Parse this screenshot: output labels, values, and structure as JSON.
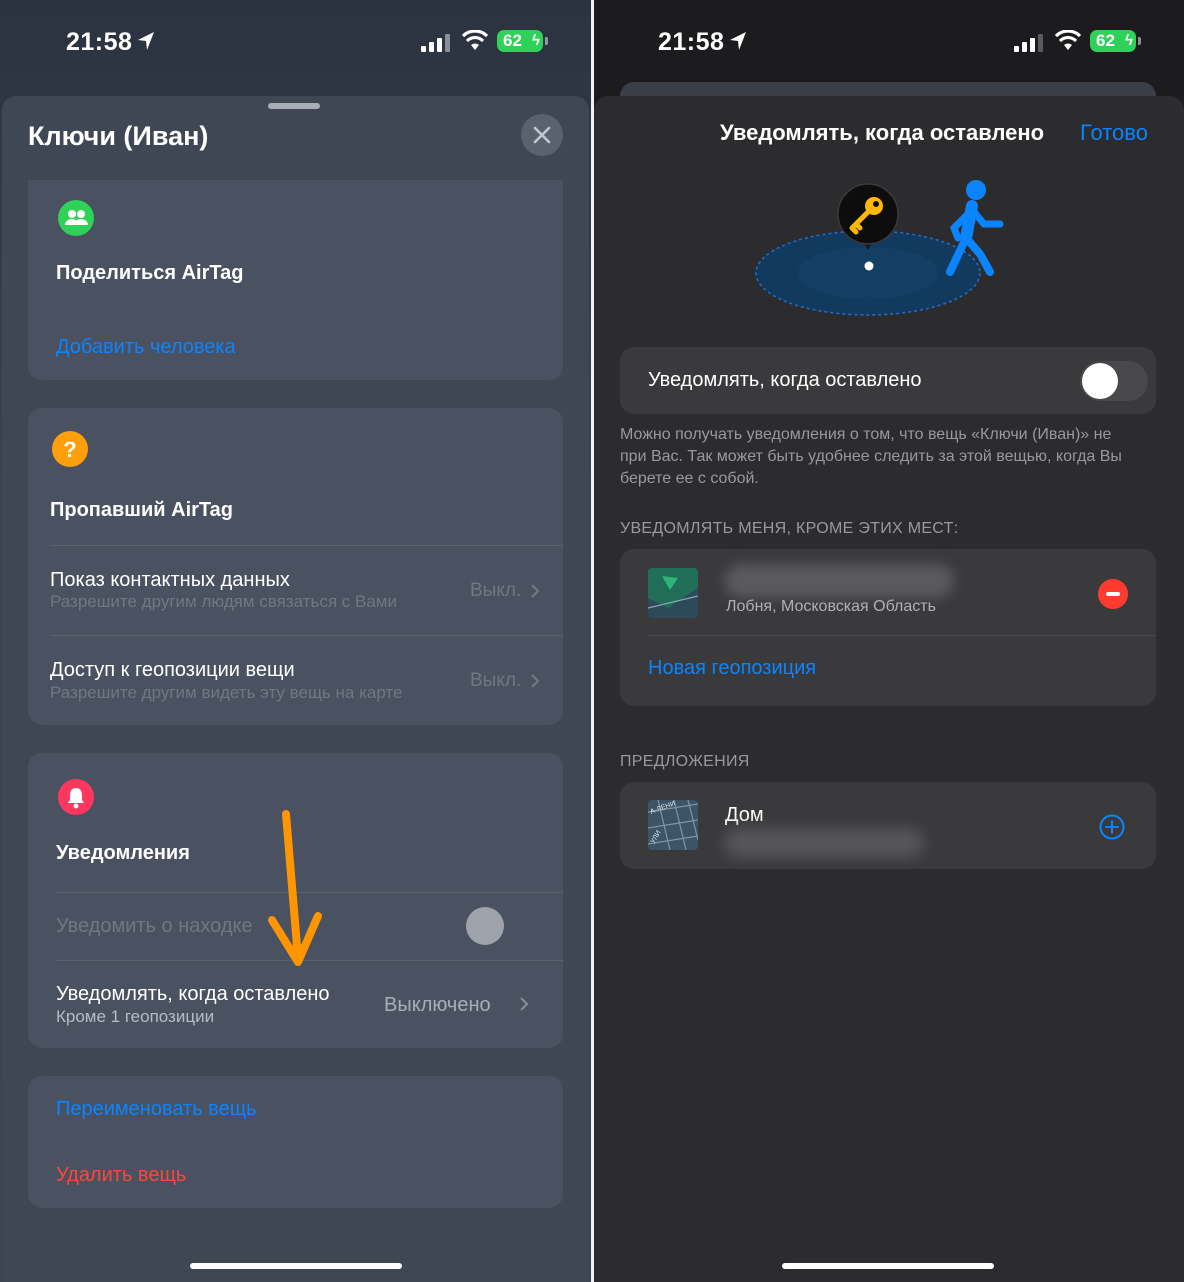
{
  "status_bar": {
    "time": "21:58",
    "battery": "62"
  },
  "left": {
    "title": "Ключи (Иван)",
    "share": {
      "title": "Поделиться AirTag",
      "add_person": "Добавить человека"
    },
    "lost": {
      "title": "Пропавший AirTag",
      "rows": [
        {
          "title": "Показ контактных данных",
          "subtitle": "Разрешите другим людям связаться с Вами",
          "value": "Выкл."
        },
        {
          "title": "Доступ к геопозиции вещи",
          "subtitle": "Разрешите другим видеть эту вещь на карте",
          "value": "Выкл."
        }
      ]
    },
    "notifications": {
      "title": "Уведомления",
      "notify_found": "Уведомить о находке",
      "left_behind": {
        "title": "Уведомлять, когда оставлено",
        "subtitle": "Кроме 1 геопозиции",
        "value": "Выключено"
      }
    },
    "actions": {
      "rename": "Переименовать вещь",
      "delete": "Удалить вещь"
    }
  },
  "right": {
    "title": "Уведомлять, когда оставлено",
    "done": "Готово",
    "toggle_label": "Уведомлять, когда оставлено",
    "toggle_on": false,
    "footnote": "Можно получать уведомления о том, что вещь «Ключи (Иван)» не при Вас. Так может быть удобнее следить за этой вещью, когда Вы берете ее с собой.",
    "except_header": "УВЕДОМЛЯТЬ МЕНЯ, КРОМЕ ЭТИХ МЕСТ:",
    "location_sub": "Лобня, Московская Область",
    "new_location": "Новая геопозиция",
    "suggestions_header": "ПРЕДЛОЖЕНИЯ",
    "suggestion_name": "Дом",
    "map_label": "А-ЛЕНИ",
    "map_label_2": "УЛИ"
  },
  "colors": {
    "accent": "#0a84ff",
    "destructive": "#ff453a",
    "green": "#30d158",
    "orange": "#ff9500"
  },
  "icons": [
    "location-arrow-icon",
    "signal-icon",
    "wifi-icon",
    "battery-icon",
    "close-icon",
    "people-icon",
    "question-icon",
    "bell-icon",
    "chevron-right-icon",
    "key-icon",
    "walking-person-icon",
    "minus-icon",
    "plus-icon"
  ]
}
